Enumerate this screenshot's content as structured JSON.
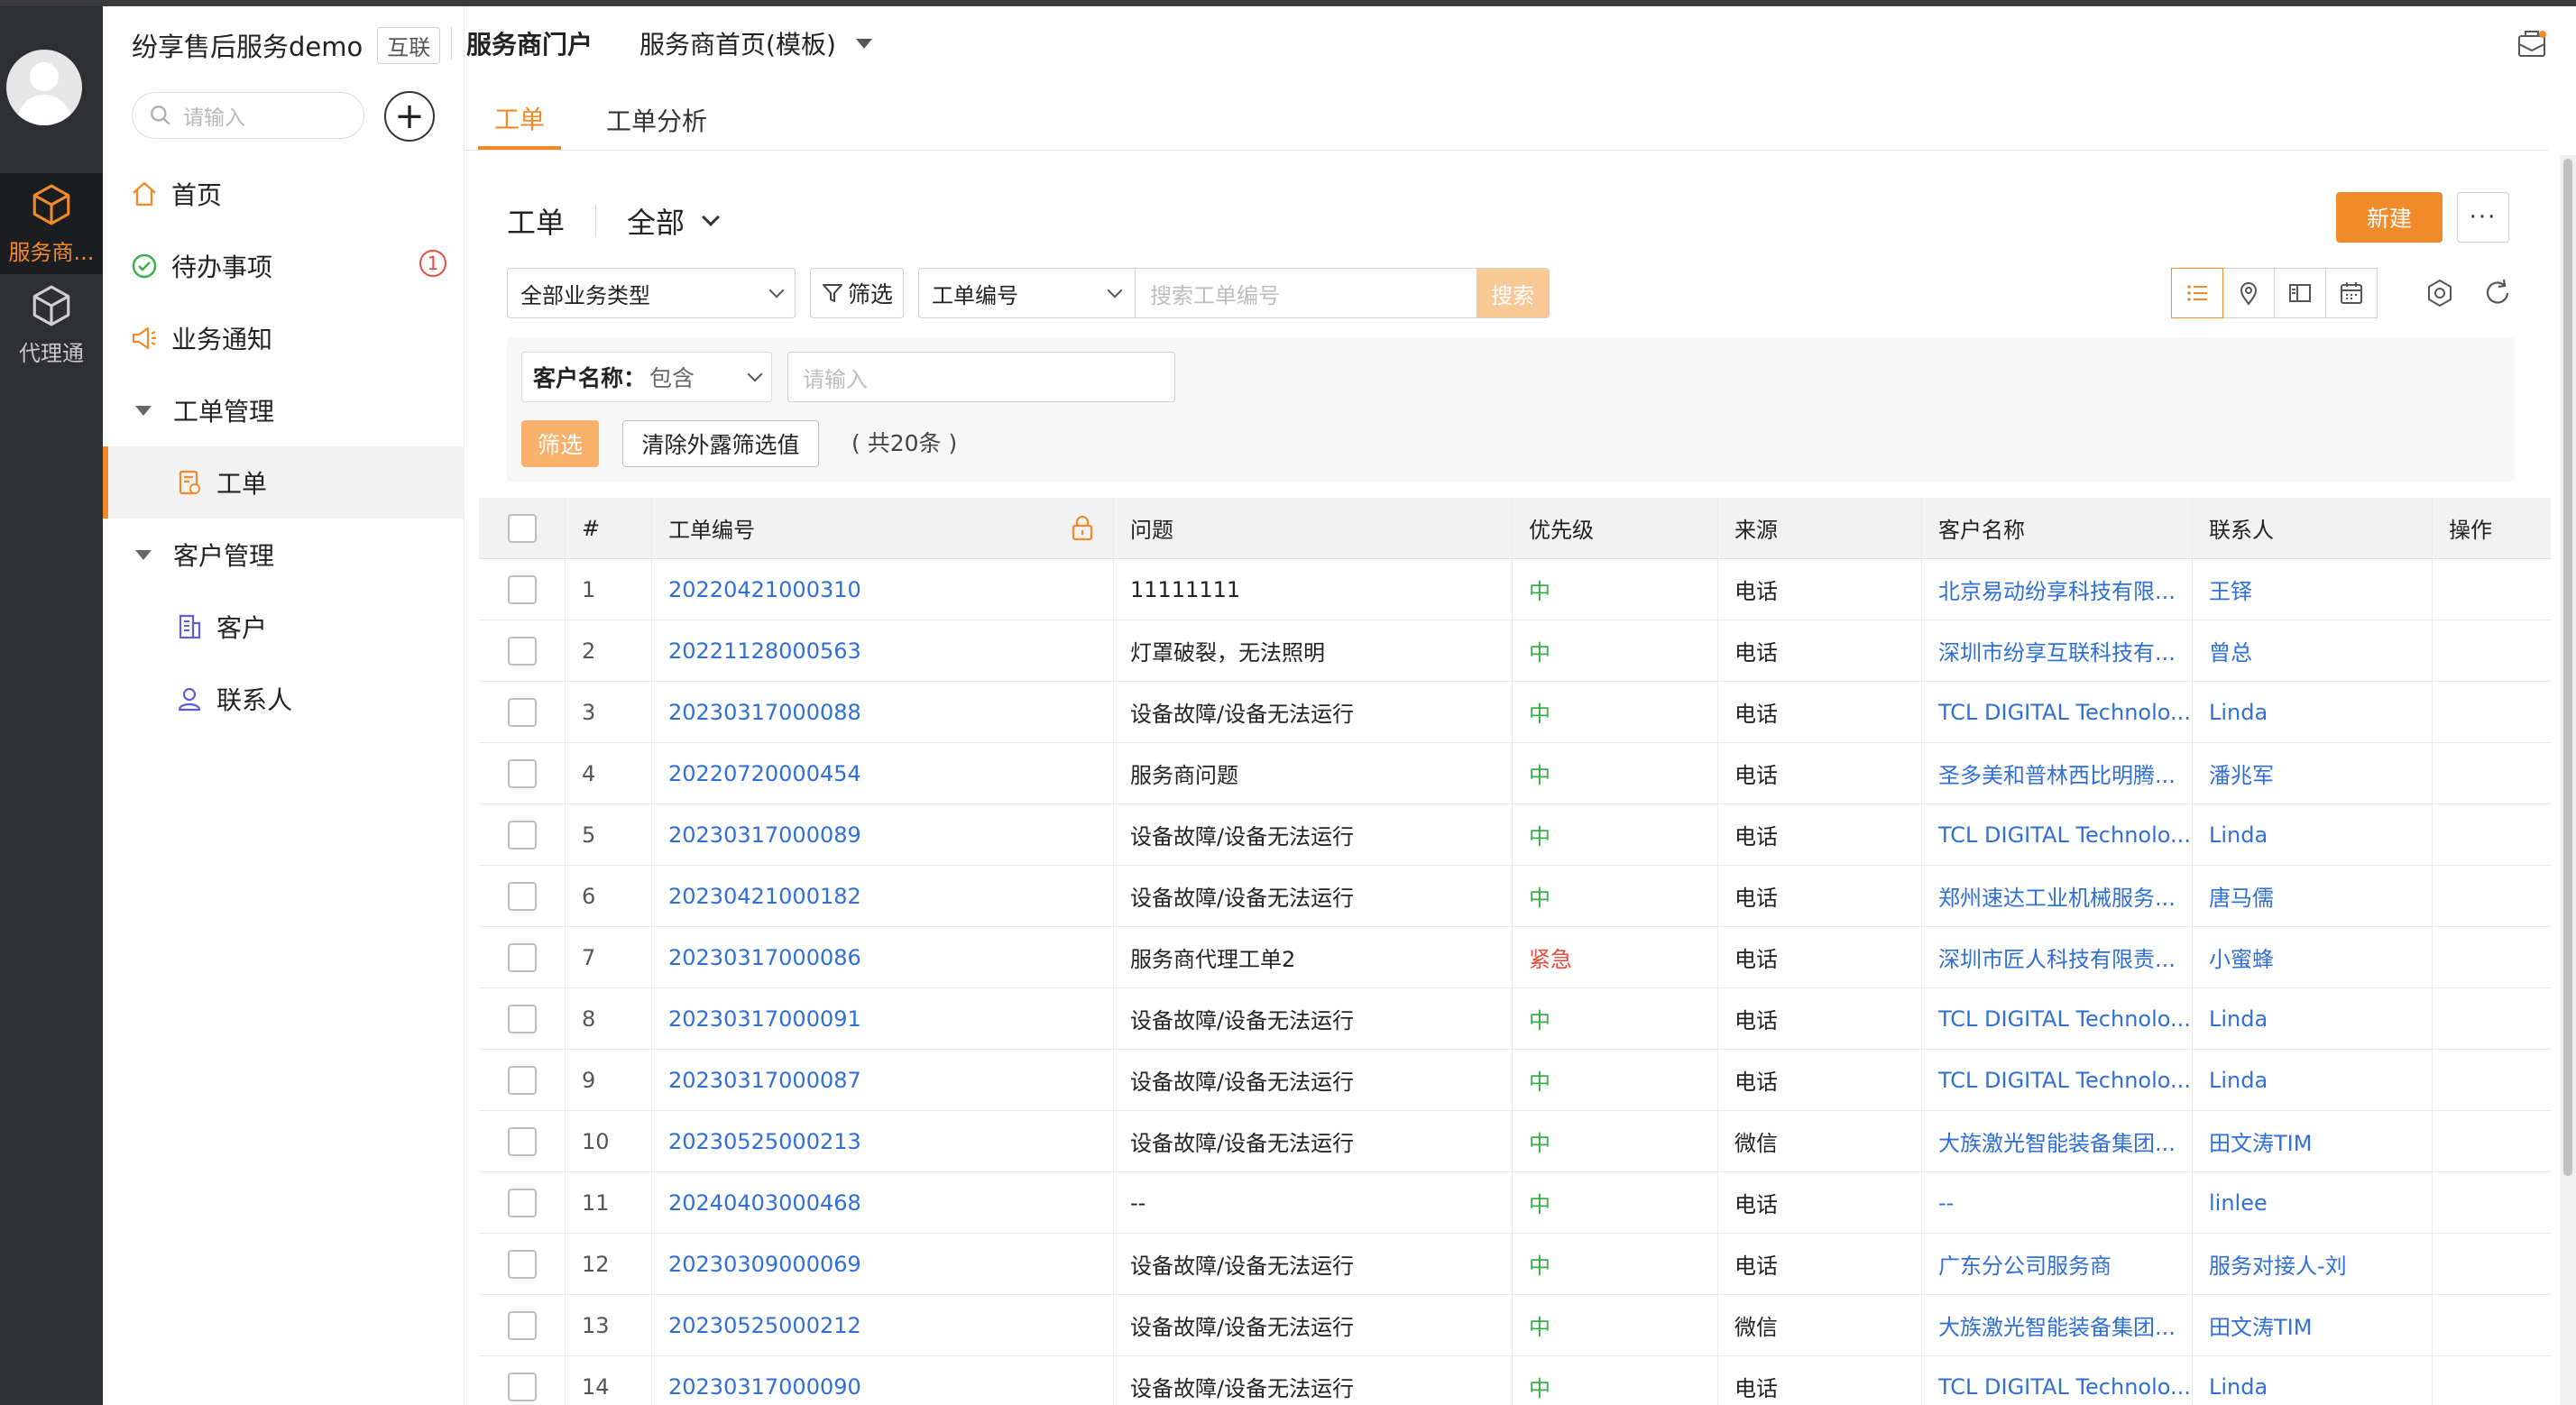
{
  "rail": {
    "items": [
      {
        "label": "服务商...",
        "icon": "cube-icon",
        "active": true
      },
      {
        "label": "代理通",
        "icon": "cube-icon",
        "active": false
      }
    ]
  },
  "sidebar": {
    "brand": "纷享售后服务demo",
    "brand_tag": "互联",
    "search_placeholder": "请输入",
    "add_label": "+",
    "items": [
      {
        "label": "首页",
        "icon": "home-icon"
      },
      {
        "label": "待办事项",
        "icon": "check-circle-icon",
        "badge": "1"
      },
      {
        "label": "业务通知",
        "icon": "megaphone-icon"
      },
      {
        "label": "工单管理",
        "icon": "caret-down-icon"
      },
      {
        "label": "工单",
        "icon": "ticket-icon"
      },
      {
        "label": "客户管理",
        "icon": "caret-down-icon"
      },
      {
        "label": "客户",
        "icon": "building-icon"
      },
      {
        "label": "联系人",
        "icon": "user-icon"
      }
    ]
  },
  "header": {
    "portal_title": "服务商门户",
    "home_select": "服务商首页(模板)",
    "mail_icon": "mail-icon"
  },
  "tabs": [
    {
      "label": "工单",
      "active": true
    },
    {
      "label": "工单分析",
      "active": false
    }
  ],
  "content": {
    "title": "工单",
    "scope": "全部",
    "new_button": "新建",
    "more_button": "···",
    "biz_type": "全部业务类型",
    "filter_label": "筛选",
    "search_field": "工单编号",
    "search_placeholder": "搜索工单编号",
    "search_button": "搜索",
    "filter_panel": {
      "cond_key": "客户名称：",
      "cond_op": "包含",
      "input_placeholder": "请输入",
      "apply_button": "筛选",
      "clear_button": "清除外露筛选值",
      "count_text": "( 共20条 )"
    }
  },
  "table": {
    "headers": [
      "#",
      "工单编号",
      "问题",
      "优先级",
      "来源",
      "客户名称",
      "联系人",
      "操作"
    ],
    "priority_colors": {
      "中": "#3aae4a",
      "紧急": "#e84a3c"
    },
    "rows": [
      {
        "idx": "1",
        "no": "20220421000310",
        "q": "11111111",
        "p": "中",
        "src": "电话",
        "cust": "北京易动纷享科技有限...",
        "ct": "王铎"
      },
      {
        "idx": "2",
        "no": "20221128000563",
        "q": "灯罩破裂，无法照明",
        "p": "中",
        "src": "电话",
        "cust": "深圳市纷享互联科技有...",
        "ct": "曾总"
      },
      {
        "idx": "3",
        "no": "20230317000088",
        "q": "设备故障/设备无法运行",
        "p": "中",
        "src": "电话",
        "cust": "TCL DIGITAL Technolo...",
        "ct": "Linda"
      },
      {
        "idx": "4",
        "no": "20220720000454",
        "q": "服务商问题",
        "p": "中",
        "src": "电话",
        "cust": "圣多美和普林西比明腾...",
        "ct": "潘兆军"
      },
      {
        "idx": "5",
        "no": "20230317000089",
        "q": "设备故障/设备无法运行",
        "p": "中",
        "src": "电话",
        "cust": "TCL DIGITAL Technolo...",
        "ct": "Linda"
      },
      {
        "idx": "6",
        "no": "20230421000182",
        "q": "设备故障/设备无法运行",
        "p": "中",
        "src": "电话",
        "cust": "郑州速达工业机械服务...",
        "ct": "唐马儒"
      },
      {
        "idx": "7",
        "no": "20230317000086",
        "q": "服务商代理工单2",
        "p": "紧急",
        "src": "电话",
        "cust": "深圳市匠人科技有限责...",
        "ct": "小蜜蜂"
      },
      {
        "idx": "8",
        "no": "20230317000091",
        "q": "设备故障/设备无法运行",
        "p": "中",
        "src": "电话",
        "cust": "TCL DIGITAL Technolo...",
        "ct": "Linda"
      },
      {
        "idx": "9",
        "no": "20230317000087",
        "q": "设备故障/设备无法运行",
        "p": "中",
        "src": "电话",
        "cust": "TCL DIGITAL Technolo...",
        "ct": "Linda"
      },
      {
        "idx": "10",
        "no": "20230525000213",
        "q": "设备故障/设备无法运行",
        "p": "中",
        "src": "微信",
        "cust": "大族激光智能装备集团...",
        "ct": "田文涛TIM"
      },
      {
        "idx": "11",
        "no": "20240403000468",
        "q": "--",
        "p": "中",
        "src": "电话",
        "cust": "--",
        "ct": "linlee"
      },
      {
        "idx": "12",
        "no": "20230309000069",
        "q": "设备故障/设备无法运行",
        "p": "中",
        "src": "电话",
        "cust": "广东分公司服务商",
        "ct": "服务对接人-刘"
      },
      {
        "idx": "13",
        "no": "20230525000212",
        "q": "设备故障/设备无法运行",
        "p": "中",
        "src": "微信",
        "cust": "大族激光智能装备集团...",
        "ct": "田文涛TIM"
      },
      {
        "idx": "14",
        "no": "20230317000090",
        "q": "设备故障/设备无法运行",
        "p": "中",
        "src": "电话",
        "cust": "TCL DIGITAL Technolo...",
        "ct": "Linda"
      }
    ]
  },
  "colors": {
    "accent": "#f08a2b",
    "link": "#2f6fd6",
    "rail_bg": "#2d2f33"
  }
}
